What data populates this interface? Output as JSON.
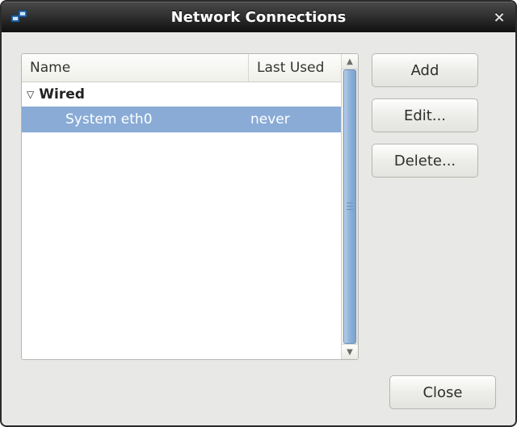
{
  "window": {
    "title": "Network Connections",
    "icon": "network-icon"
  },
  "columns": {
    "name": "Name",
    "last_used": "Last Used"
  },
  "groups": [
    {
      "label": "Wired",
      "expanded": true,
      "items": [
        {
          "name": "System eth0",
          "last_used": "never",
          "selected": true
        }
      ]
    }
  ],
  "buttons": {
    "add": "Add",
    "edit": "Edit...",
    "delete": "Delete...",
    "close": "Close"
  }
}
